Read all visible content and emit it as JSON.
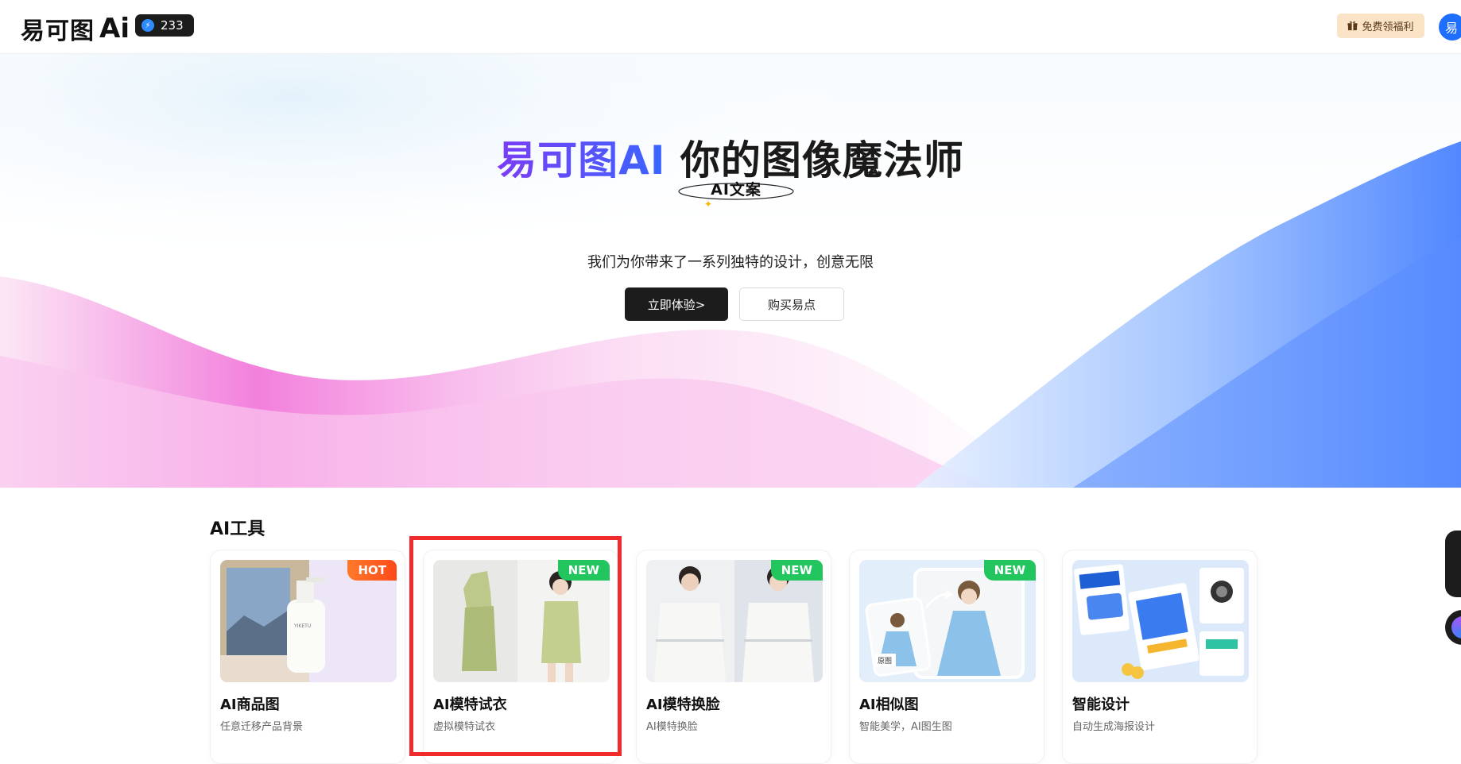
{
  "header": {
    "logo_text": "易可图",
    "logo_ai": "Ai",
    "points": "233",
    "gift_label": "免费领福利",
    "avatar_initial": "易"
  },
  "hero": {
    "title_brand": "易可图AI",
    "title_rest": " 你的图像魔法师",
    "badge": "AI文案",
    "subtitle": "我们为你带来了一系列独特的设计，创意无限",
    "primary_button": "立即体验>",
    "secondary_button": "购买易点"
  },
  "tools": {
    "section_title": "AI工具",
    "cards": [
      {
        "name": "AI商品图",
        "desc": "任意迁移产品背景",
        "tag": "HOT",
        "tag_type": "hot"
      },
      {
        "name": "AI模特试衣",
        "desc": "虚拟模特试衣",
        "tag": "NEW",
        "tag_type": "new"
      },
      {
        "name": "AI模特换脸",
        "desc": "AI模特换脸",
        "tag": "NEW",
        "tag_type": "new"
      },
      {
        "name": "AI相似图",
        "desc": "智能美学，AI图生图",
        "tag": "NEW",
        "tag_type": "new"
      },
      {
        "name": "智能设计",
        "desc": "自动生成海报设计",
        "tag": "",
        "tag_type": ""
      }
    ],
    "product_label": "YIKETU",
    "origin_label": "原图"
  },
  "colors": {
    "brand_purple": "#7b3cf5",
    "brand_blue": "#3a66ff",
    "highlight_red": "#ef2b2b",
    "new_green": "#22c55e",
    "hot_orange": "#ff5a1f"
  },
  "icons": {
    "points": "bolt-icon",
    "gift": "gift-icon"
  }
}
